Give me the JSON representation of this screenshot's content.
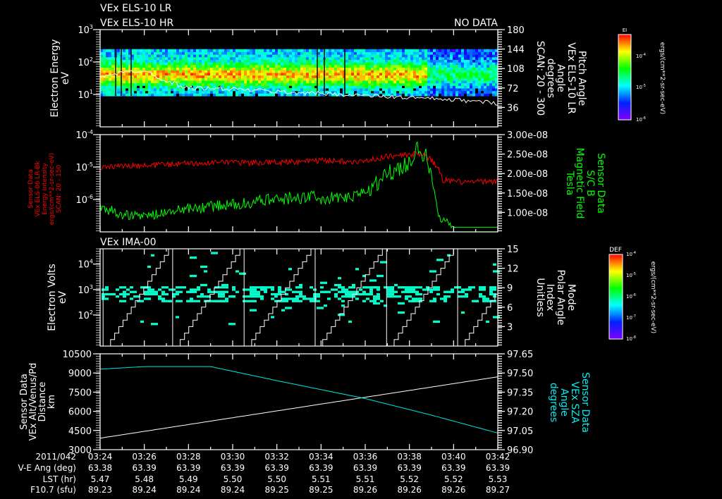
{
  "header": {
    "title_lr": "VEx ELS-10 LR",
    "title_hr": "VEx ELS-10 HR",
    "no_data": "NO DATA"
  },
  "colors": {
    "background": "#000000",
    "axis": "#ffffff",
    "els_intensity": "#ff0000",
    "magnetic_field": "#00ff00",
    "sza": "#00e5e5",
    "altitude": "#ffffff"
  },
  "time_axis": {
    "ticks": [
      "03:24",
      "03:26",
      "03:28",
      "03:30",
      "03:32",
      "03:34",
      "03:36",
      "03:38",
      "03:40",
      "03:42"
    ],
    "range": [
      "03:24",
      "03:42"
    ]
  },
  "ephemeris": {
    "rows": [
      {
        "label": "2011/042",
        "values": [
          "03:24",
          "03:26",
          "03:28",
          "03:30",
          "03:32",
          "03:34",
          "03:36",
          "03:38",
          "03:40",
          "03:42"
        ]
      },
      {
        "label": "V-E Ang (deg)",
        "values": [
          "63.38",
          "63.39",
          "63.39",
          "63.39",
          "63.39",
          "63.39",
          "63.39",
          "63.39",
          "63.39",
          "63.39"
        ]
      },
      {
        "label": "LST (hr)",
        "values": [
          "5.47",
          "5.48",
          "5.49",
          "5.50",
          "5.50",
          "5.51",
          "5.51",
          "5.52",
          "5.52",
          "5.53"
        ]
      },
      {
        "label": "F10.7 (sfu)",
        "values": [
          "89.23",
          "89.24",
          "89.24",
          "89.24",
          "89.25",
          "89.25",
          "89.26",
          "89.26",
          "89.26",
          "89.27"
        ]
      }
    ]
  },
  "chart_data": [
    {
      "type": "heatmap",
      "panel": "els",
      "ylabel": [
        "Electron Energy",
        "eV"
      ],
      "yscale": "log",
      "ylim": [
        1,
        1000
      ],
      "yticks": [
        {
          "base": "10",
          "exp": "3",
          "value": 1000
        },
        {
          "base": "10",
          "exp": "2",
          "value": 100
        },
        {
          "base": "10",
          "exp": "1",
          "value": 10
        }
      ],
      "energy_band_eV": [
        9,
        250
      ],
      "y2label": [
        "Pitch Angle",
        "VEx ELS-10 LR",
        "Angle",
        "degrees",
        "SCAN: 20 - 300"
      ],
      "y2lim": [
        0,
        180
      ],
      "y2ticks": [
        "180",
        "144",
        "108",
        "72",
        "36"
      ],
      "pitch_angle_line": {
        "x": [
          "03:24",
          "03:25",
          "03:26",
          "03:27",
          "03:28",
          "03:30",
          "03:32",
          "03:34",
          "03:36",
          "03:38",
          "03:40",
          "03:42"
        ],
        "y": [
          95,
          100,
          105,
          85,
          72,
          70,
          65,
          62,
          58,
          54,
          50,
          44
        ]
      },
      "colorbar": {
        "label": "EI",
        "ticks": [
          {
            "base": "10",
            "exp": "-4"
          },
          {
            "base": "10",
            "exp": "-5"
          },
          {
            "base": "10",
            "exp": "-6"
          }
        ],
        "units": "ergs/(cm**2-sr-sec-eV)",
        "colormap": "rainbow"
      }
    },
    {
      "type": "line",
      "panel": "els_b",
      "ylabel": [
        "Sensor Data",
        "VEx ELS-06 LR-Bk",
        "Energy Intensity",
        "ergs/(cm**2-sr-sec-eV)",
        "SCAN: 20 - 150"
      ],
      "yscale": "log",
      "ylim": [
        1e-07,
        0.0001
      ],
      "yticks": [
        {
          "base": "10",
          "exp": "-4",
          "value": 0.0001
        },
        {
          "base": "10",
          "exp": "-5",
          "value": 1e-05
        },
        {
          "base": "10",
          "exp": "-6",
          "value": 1e-06
        }
      ],
      "y2label": [
        "Sensor Data",
        "S/C B",
        "Magnetic Field",
        "Tesla"
      ],
      "y2lim": [
        5e-09,
        3e-08
      ],
      "y2ticks": [
        "3.00e-08",
        "2.50e-08",
        "2.00e-08",
        "1.50e-08",
        "1.00e-08"
      ],
      "series": [
        {
          "axis": "left",
          "x": [
            "03:24",
            "03:26",
            "03:27",
            "03:28",
            "03:32",
            "03:34",
            "03:36",
            "03:37",
            "03:38:30",
            "03:39",
            "03:39:30",
            "03:40",
            "03:42"
          ],
          "y": [
            1e-05,
            1.1e-05,
            1.2e-05,
            1.3e-05,
            1.4e-05,
            1.6e-05,
            1.5e-05,
            2.1e-05,
            2.6e-05,
            1.6e-05,
            4e-06,
            3.5e-06,
            3.5e-06
          ]
        },
        {
          "axis": "right",
          "x": [
            "03:24",
            "03:25",
            "03:26",
            "03:28",
            "03:30",
            "03:33",
            "03:35",
            "03:36",
            "03:37",
            "03:38",
            "03:38:30",
            "03:39",
            "03:39:20",
            "03:40",
            "03:42"
          ],
          "y": [
            1.15e-08,
            9.5e-09,
            9e-09,
            1.1e-08,
            1.2e-08,
            1.4e-08,
            1.35e-08,
            1.5e-08,
            2e-08,
            2.3e-08,
            2.75e-08,
            2e-08,
            9e-09,
            6.2e-09,
            6.2e-09
          ]
        }
      ]
    },
    {
      "type": "heatmap",
      "panel": "ima",
      "title": "VEx IMA-00",
      "ylabel": [
        "Electron Volts",
        "eV"
      ],
      "yscale": "log",
      "ylim": [
        6,
        40000
      ],
      "yticks": [
        {
          "base": "10",
          "exp": "4",
          "value": 10000
        },
        {
          "base": "10",
          "exp": "3",
          "value": 1000
        },
        {
          "base": "10",
          "exp": "2",
          "value": 100
        }
      ],
      "y2label": [
        "Mode",
        "Polar Angle",
        "Index",
        "Unitless"
      ],
      "y2lim": [
        0,
        15
      ],
      "y2ticks": [
        "15",
        "12",
        "9",
        "6",
        "3"
      ],
      "polar_angle_cycle_starts": [
        "03:24:08",
        "03:27:17",
        "03:30:31",
        "03:33:44",
        "03:36:58",
        "03:40:11"
      ],
      "colorbar": {
        "label": "DEF",
        "ticks": [
          {
            "base": "10",
            "exp": "-4"
          },
          {
            "base": "10",
            "exp": "-5"
          },
          {
            "base": "10",
            "exp": "-6"
          },
          {
            "base": "10",
            "exp": "-7"
          },
          {
            "base": "10",
            "exp": "-8"
          }
        ],
        "units": "ergs/(cm**2-sr-sec-eV)",
        "colormap": "rainbow"
      }
    },
    {
      "type": "line",
      "panel": "orbit",
      "ylabel": [
        "Sensor Data",
        "VEx Alt/Venus/Pd",
        "Distance",
        "km"
      ],
      "ylim": [
        3000,
        10500
      ],
      "yticks": [
        "10500",
        "9000",
        "7500",
        "6000",
        "4500",
        "3000"
      ],
      "y2label": [
        "Sensor Data",
        "VEx SZA",
        "Angle",
        "degrees"
      ],
      "y2lim": [
        96.9,
        97.65
      ],
      "y2ticks": [
        "97.65",
        "97.50",
        "97.35",
        "97.20",
        "97.05",
        "96.90"
      ],
      "series": [
        {
          "axis": "left",
          "x": [
            "03:24",
            "03:42"
          ],
          "y": [
            3900,
            8700
          ]
        },
        {
          "axis": "right",
          "x": [
            "03:24",
            "03:26",
            "03:29",
            "03:32",
            "03:36",
            "03:39",
            "03:42"
          ],
          "y": [
            97.53,
            97.55,
            97.55,
            97.44,
            97.3,
            97.17,
            97.03
          ]
        }
      ]
    }
  ]
}
